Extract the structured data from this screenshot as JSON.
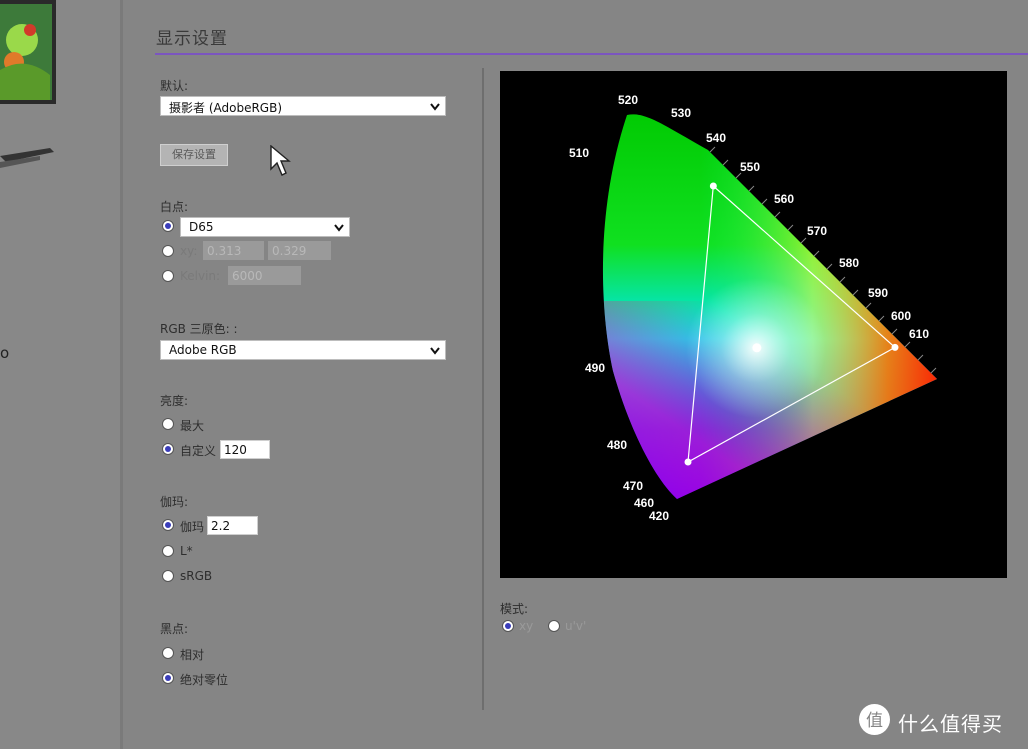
{
  "page_title": "显示设置",
  "stray_char": "o",
  "preset": {
    "label": "默认:",
    "value": "摄影者 (AdobeRGB)"
  },
  "save_button": "保存设置",
  "white_point": {
    "label": "白点:",
    "options": [
      {
        "type": "select",
        "value": "D65",
        "selected": true
      },
      {
        "label": "xy:",
        "x": "0.313",
        "y": "0.329",
        "selected": false
      },
      {
        "label": "Kelvin:",
        "value": "6000",
        "selected": false
      }
    ]
  },
  "rgb_primaries": {
    "label": "RGB 三原色: :",
    "value": "Adobe RGB"
  },
  "brightness": {
    "label": "亮度:",
    "options": [
      {
        "label": "最大",
        "selected": false
      },
      {
        "label": "自定义",
        "value": "120",
        "selected": true
      }
    ]
  },
  "gamma": {
    "label": "伽玛:",
    "options": [
      {
        "label": "伽玛",
        "value": "2.2",
        "selected": true
      },
      {
        "label": "L*",
        "selected": false
      },
      {
        "label": "sRGB",
        "selected": false
      }
    ]
  },
  "black_point": {
    "label": "黑点:",
    "options": [
      {
        "label": "相对",
        "selected": false
      },
      {
        "label": "绝对零位",
        "selected": true
      }
    ]
  },
  "mode": {
    "label": "模式:",
    "options": [
      {
        "label": "xy",
        "selected": true
      },
      {
        "label": "u'v'",
        "selected": false
      }
    ]
  },
  "chart_data": {
    "type": "scatter",
    "title": "",
    "xlabel": "",
    "ylabel": "",
    "wavelength_labels": [
      "520",
      "530",
      "540",
      "550",
      "560",
      "570",
      "580",
      "590",
      "600",
      "610",
      "490",
      "480",
      "470",
      "460",
      "420",
      "510"
    ],
    "gamut_triangle": {
      "name": "Adobe RGB",
      "points": [
        {
          "label": "R",
          "x": 0.64,
          "y": 0.33
        },
        {
          "label": "G",
          "x": 0.21,
          "y": 0.71
        },
        {
          "label": "B",
          "x": 0.15,
          "y": 0.06
        }
      ]
    },
    "white_point": {
      "x": 0.313,
      "y": 0.329
    },
    "background": "#000000"
  },
  "watermark": "什么值得买",
  "colors": {
    "accent": "#7b55c0",
    "radio_selected": "#3a3dba"
  }
}
